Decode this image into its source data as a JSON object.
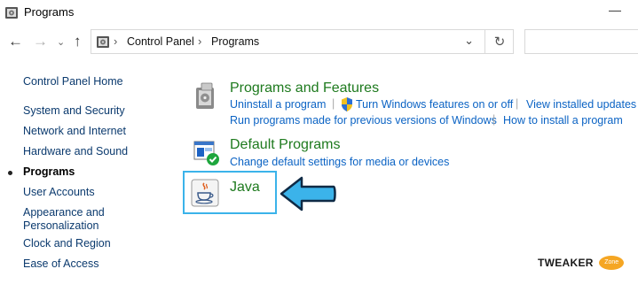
{
  "window": {
    "title": "Programs",
    "minimize_glyph": "—"
  },
  "nav": {
    "back_icon": "arrow-left-icon",
    "forward_icon": "arrow-right-icon",
    "history_icon": "chevron-down-icon",
    "up_icon": "arrow-up-icon",
    "address": {
      "crumbs": [
        "Control Panel",
        "Programs"
      ]
    },
    "search_placeholder": ""
  },
  "sidebar": {
    "items": [
      {
        "label": "Control Panel Home"
      },
      {
        "label": "System and Security"
      },
      {
        "label": "Network and Internet"
      },
      {
        "label": "Hardware and Sound"
      },
      {
        "label": "Programs",
        "active": true
      },
      {
        "label": "User Accounts"
      },
      {
        "label": "Appearance and\nPersonalization"
      },
      {
        "label": "Clock and Region"
      },
      {
        "label": "Ease of Access"
      }
    ]
  },
  "categories": {
    "programs_features": {
      "title": "Programs and Features",
      "links": [
        "Uninstall a program",
        "Turn Windows features on or off",
        "View installed updates",
        "Run programs made for previous versions of Windows",
        "How to install a program"
      ]
    },
    "default_programs": {
      "title": "Default Programs",
      "links": [
        "Change default settings for media or devices"
      ]
    },
    "java": {
      "title": "Java"
    }
  },
  "watermark": {
    "text": "TWEAKER",
    "badge": "Zone"
  },
  "colors": {
    "link": "#0b63c4",
    "category": "#1e7a1e",
    "highlight": "#3bb3ea",
    "arrow": "#3bb3ea"
  }
}
